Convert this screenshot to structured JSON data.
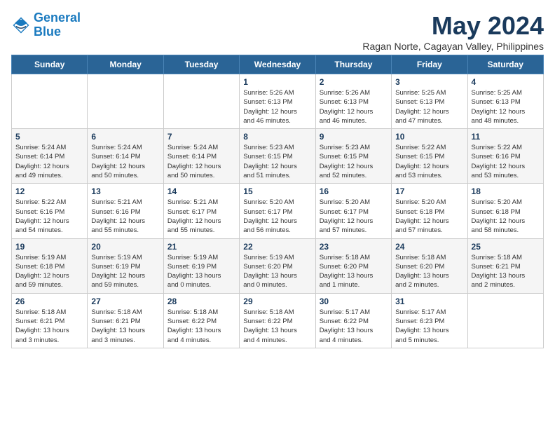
{
  "header": {
    "logo_line1": "General",
    "logo_line2": "Blue",
    "month": "May 2024",
    "location": "Ragan Norte, Cagayan Valley, Philippines"
  },
  "weekdays": [
    "Sunday",
    "Monday",
    "Tuesday",
    "Wednesday",
    "Thursday",
    "Friday",
    "Saturday"
  ],
  "weeks": [
    [
      {
        "day": "",
        "info": ""
      },
      {
        "day": "",
        "info": ""
      },
      {
        "day": "",
        "info": ""
      },
      {
        "day": "1",
        "info": "Sunrise: 5:26 AM\nSunset: 6:13 PM\nDaylight: 12 hours\nand 46 minutes."
      },
      {
        "day": "2",
        "info": "Sunrise: 5:26 AM\nSunset: 6:13 PM\nDaylight: 12 hours\nand 46 minutes."
      },
      {
        "day": "3",
        "info": "Sunrise: 5:25 AM\nSunset: 6:13 PM\nDaylight: 12 hours\nand 47 minutes."
      },
      {
        "day": "4",
        "info": "Sunrise: 5:25 AM\nSunset: 6:13 PM\nDaylight: 12 hours\nand 48 minutes."
      }
    ],
    [
      {
        "day": "5",
        "info": "Sunrise: 5:24 AM\nSunset: 6:14 PM\nDaylight: 12 hours\nand 49 minutes."
      },
      {
        "day": "6",
        "info": "Sunrise: 5:24 AM\nSunset: 6:14 PM\nDaylight: 12 hours\nand 50 minutes."
      },
      {
        "day": "7",
        "info": "Sunrise: 5:24 AM\nSunset: 6:14 PM\nDaylight: 12 hours\nand 50 minutes."
      },
      {
        "day": "8",
        "info": "Sunrise: 5:23 AM\nSunset: 6:15 PM\nDaylight: 12 hours\nand 51 minutes."
      },
      {
        "day": "9",
        "info": "Sunrise: 5:23 AM\nSunset: 6:15 PM\nDaylight: 12 hours\nand 52 minutes."
      },
      {
        "day": "10",
        "info": "Sunrise: 5:22 AM\nSunset: 6:15 PM\nDaylight: 12 hours\nand 53 minutes."
      },
      {
        "day": "11",
        "info": "Sunrise: 5:22 AM\nSunset: 6:16 PM\nDaylight: 12 hours\nand 53 minutes."
      }
    ],
    [
      {
        "day": "12",
        "info": "Sunrise: 5:22 AM\nSunset: 6:16 PM\nDaylight: 12 hours\nand 54 minutes."
      },
      {
        "day": "13",
        "info": "Sunrise: 5:21 AM\nSunset: 6:16 PM\nDaylight: 12 hours\nand 55 minutes."
      },
      {
        "day": "14",
        "info": "Sunrise: 5:21 AM\nSunset: 6:17 PM\nDaylight: 12 hours\nand 55 minutes."
      },
      {
        "day": "15",
        "info": "Sunrise: 5:20 AM\nSunset: 6:17 PM\nDaylight: 12 hours\nand 56 minutes."
      },
      {
        "day": "16",
        "info": "Sunrise: 5:20 AM\nSunset: 6:17 PM\nDaylight: 12 hours\nand 57 minutes."
      },
      {
        "day": "17",
        "info": "Sunrise: 5:20 AM\nSunset: 6:18 PM\nDaylight: 12 hours\nand 57 minutes."
      },
      {
        "day": "18",
        "info": "Sunrise: 5:20 AM\nSunset: 6:18 PM\nDaylight: 12 hours\nand 58 minutes."
      }
    ],
    [
      {
        "day": "19",
        "info": "Sunrise: 5:19 AM\nSunset: 6:18 PM\nDaylight: 12 hours\nand 59 minutes."
      },
      {
        "day": "20",
        "info": "Sunrise: 5:19 AM\nSunset: 6:19 PM\nDaylight: 12 hours\nand 59 minutes."
      },
      {
        "day": "21",
        "info": "Sunrise: 5:19 AM\nSunset: 6:19 PM\nDaylight: 13 hours\nand 0 minutes."
      },
      {
        "day": "22",
        "info": "Sunrise: 5:19 AM\nSunset: 6:20 PM\nDaylight: 13 hours\nand 0 minutes."
      },
      {
        "day": "23",
        "info": "Sunrise: 5:18 AM\nSunset: 6:20 PM\nDaylight: 13 hours\nand 1 minute."
      },
      {
        "day": "24",
        "info": "Sunrise: 5:18 AM\nSunset: 6:20 PM\nDaylight: 13 hours\nand 2 minutes."
      },
      {
        "day": "25",
        "info": "Sunrise: 5:18 AM\nSunset: 6:21 PM\nDaylight: 13 hours\nand 2 minutes."
      }
    ],
    [
      {
        "day": "26",
        "info": "Sunrise: 5:18 AM\nSunset: 6:21 PM\nDaylight: 13 hours\nand 3 minutes."
      },
      {
        "day": "27",
        "info": "Sunrise: 5:18 AM\nSunset: 6:21 PM\nDaylight: 13 hours\nand 3 minutes."
      },
      {
        "day": "28",
        "info": "Sunrise: 5:18 AM\nSunset: 6:22 PM\nDaylight: 13 hours\nand 4 minutes."
      },
      {
        "day": "29",
        "info": "Sunrise: 5:18 AM\nSunset: 6:22 PM\nDaylight: 13 hours\nand 4 minutes."
      },
      {
        "day": "30",
        "info": "Sunrise: 5:17 AM\nSunset: 6:22 PM\nDaylight: 13 hours\nand 4 minutes."
      },
      {
        "day": "31",
        "info": "Sunrise: 5:17 AM\nSunset: 6:23 PM\nDaylight: 13 hours\nand 5 minutes."
      },
      {
        "day": "",
        "info": ""
      }
    ]
  ]
}
